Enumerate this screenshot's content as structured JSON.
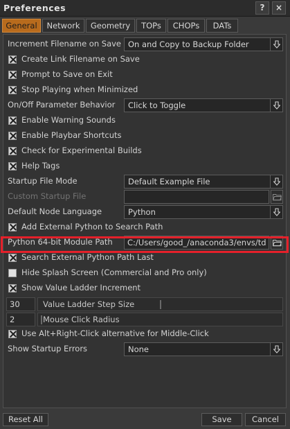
{
  "window": {
    "title": "Preferences",
    "help_label": "?",
    "close_label": "×"
  },
  "tabs": [
    {
      "label": "General",
      "active": true
    },
    {
      "label": "Network",
      "active": false
    },
    {
      "label": "Geometry",
      "active": false
    },
    {
      "label": "TOPs",
      "active": false
    },
    {
      "label": "CHOPs",
      "active": false
    },
    {
      "label": "DATs",
      "active": false
    }
  ],
  "settings": {
    "increment_filename": {
      "label": "Increment Filename on Save",
      "value": "On and Copy to Backup Folder"
    },
    "create_link_filename": {
      "label": "Create Link Filename on Save",
      "checked": true
    },
    "prompt_to_save": {
      "label": "Prompt to Save on Exit",
      "checked": true
    },
    "stop_playing": {
      "label": "Stop Playing when Minimized",
      "checked": true
    },
    "onoff_behavior": {
      "label": "On/Off Parameter Behavior",
      "value": "Click to Toggle"
    },
    "enable_warning_sounds": {
      "label": "Enable Warning Sounds",
      "checked": true
    },
    "enable_playbar_shortcuts": {
      "label": "Enable Playbar Shortcuts",
      "checked": true
    },
    "check_experimental": {
      "label": "Check for Experimental Builds",
      "checked": true
    },
    "help_tags": {
      "label": "Help Tags",
      "checked": true
    },
    "startup_file_mode": {
      "label": "Startup File Mode",
      "value": "Default Example File"
    },
    "custom_startup_file": {
      "label": "Custom Startup File",
      "value": ""
    },
    "default_node_language": {
      "label": "Default Node Language",
      "value": "Python"
    },
    "add_external_python": {
      "label": "Add External Python to Search Path",
      "checked": true
    },
    "python_module_path": {
      "label": "Python 64-bit Module Path",
      "value": "C:/Users/good_/anaconda3/envs/td"
    },
    "search_external_last": {
      "label": "Search External Python Path Last",
      "checked": true
    },
    "hide_splash": {
      "label": "Hide Splash Screen (Commercial and Pro only)",
      "checked": false
    },
    "show_value_ladder": {
      "label": "Show Value Ladder Increment",
      "checked": true
    },
    "value_ladder_step": {
      "label": "Value Ladder Step Size",
      "value": "30",
      "level": 0.5
    },
    "mouse_click_radius": {
      "label": "Mouse Click Radius",
      "value": "2",
      "level": 0.0
    },
    "alt_right_click": {
      "label": "Use Alt+Right-Click alternative for Middle-Click",
      "checked": true
    },
    "show_startup_errors": {
      "label": "Show Startup Errors",
      "value": "None"
    }
  },
  "footer": {
    "reset_label": "Reset All",
    "save_label": "Save",
    "cancel_label": "Cancel"
  },
  "colors": {
    "accent": "#b86b1d",
    "highlight": "#e5202a",
    "background": "#3a3a3a"
  }
}
